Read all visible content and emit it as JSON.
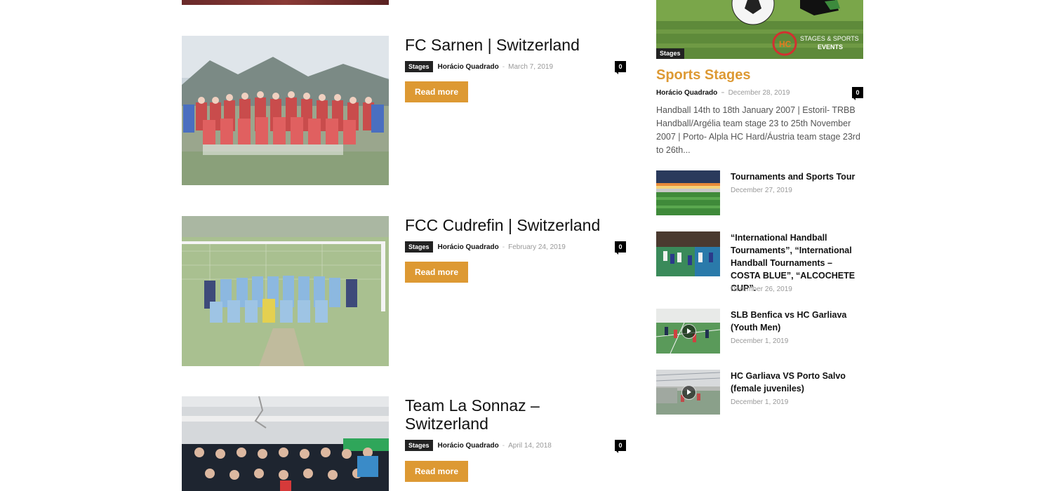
{
  "posts": [
    {
      "title": "FC Sarnen | Switzerland",
      "category": "Stages",
      "author": "Horácio Quadrado",
      "date": "March 7, 2019",
      "comments": "0",
      "read_more": "Read more"
    },
    {
      "title": "FCC Cudrefin | Switzerland",
      "category": "Stages",
      "author": "Horácio Quadrado",
      "date": "February 24, 2019",
      "comments": "0",
      "read_more": "Read more"
    },
    {
      "title": "Team La Sonnaz – Switzerland",
      "category": "Stages",
      "author": "Horácio Quadrado",
      "date": "April 14, 2018",
      "comments": "0",
      "read_more": "Read more"
    }
  ],
  "sidebar": {
    "featured": {
      "logo_text_1": "STAGES & SPORTS",
      "logo_text_2": "EVENTS",
      "category": "Stages",
      "title": "Sports Stages",
      "author": "Horácio Quadrado",
      "date": "December 28, 2019",
      "comments": "0",
      "excerpt": "Handball 14th to 18th January 2007 | Estoril- TRBB Handball/Argélia team stage 23 to 25th November 2007 | Porto- Alpla HC Hard/Áustria team stage 23rd to 26th..."
    },
    "items": [
      {
        "title": "Tournaments and Sports Tour",
        "date": "December 27, 2019"
      },
      {
        "title": "“International Handball Tournaments”, “International Handball Tournaments – COSTA BLUE”, “ALCOCHETE CUP”.",
        "date": "December 26, 2019"
      },
      {
        "title": "SLB Benfica vs HC Garliava (Youth Men)",
        "date": "December 1, 2019"
      },
      {
        "title": "HC Garliava VS Porto Salvo (female juveniles)",
        "date": "December 1, 2019"
      }
    ]
  },
  "colors": {
    "accent": "#dd9933",
    "dark": "#222222"
  }
}
